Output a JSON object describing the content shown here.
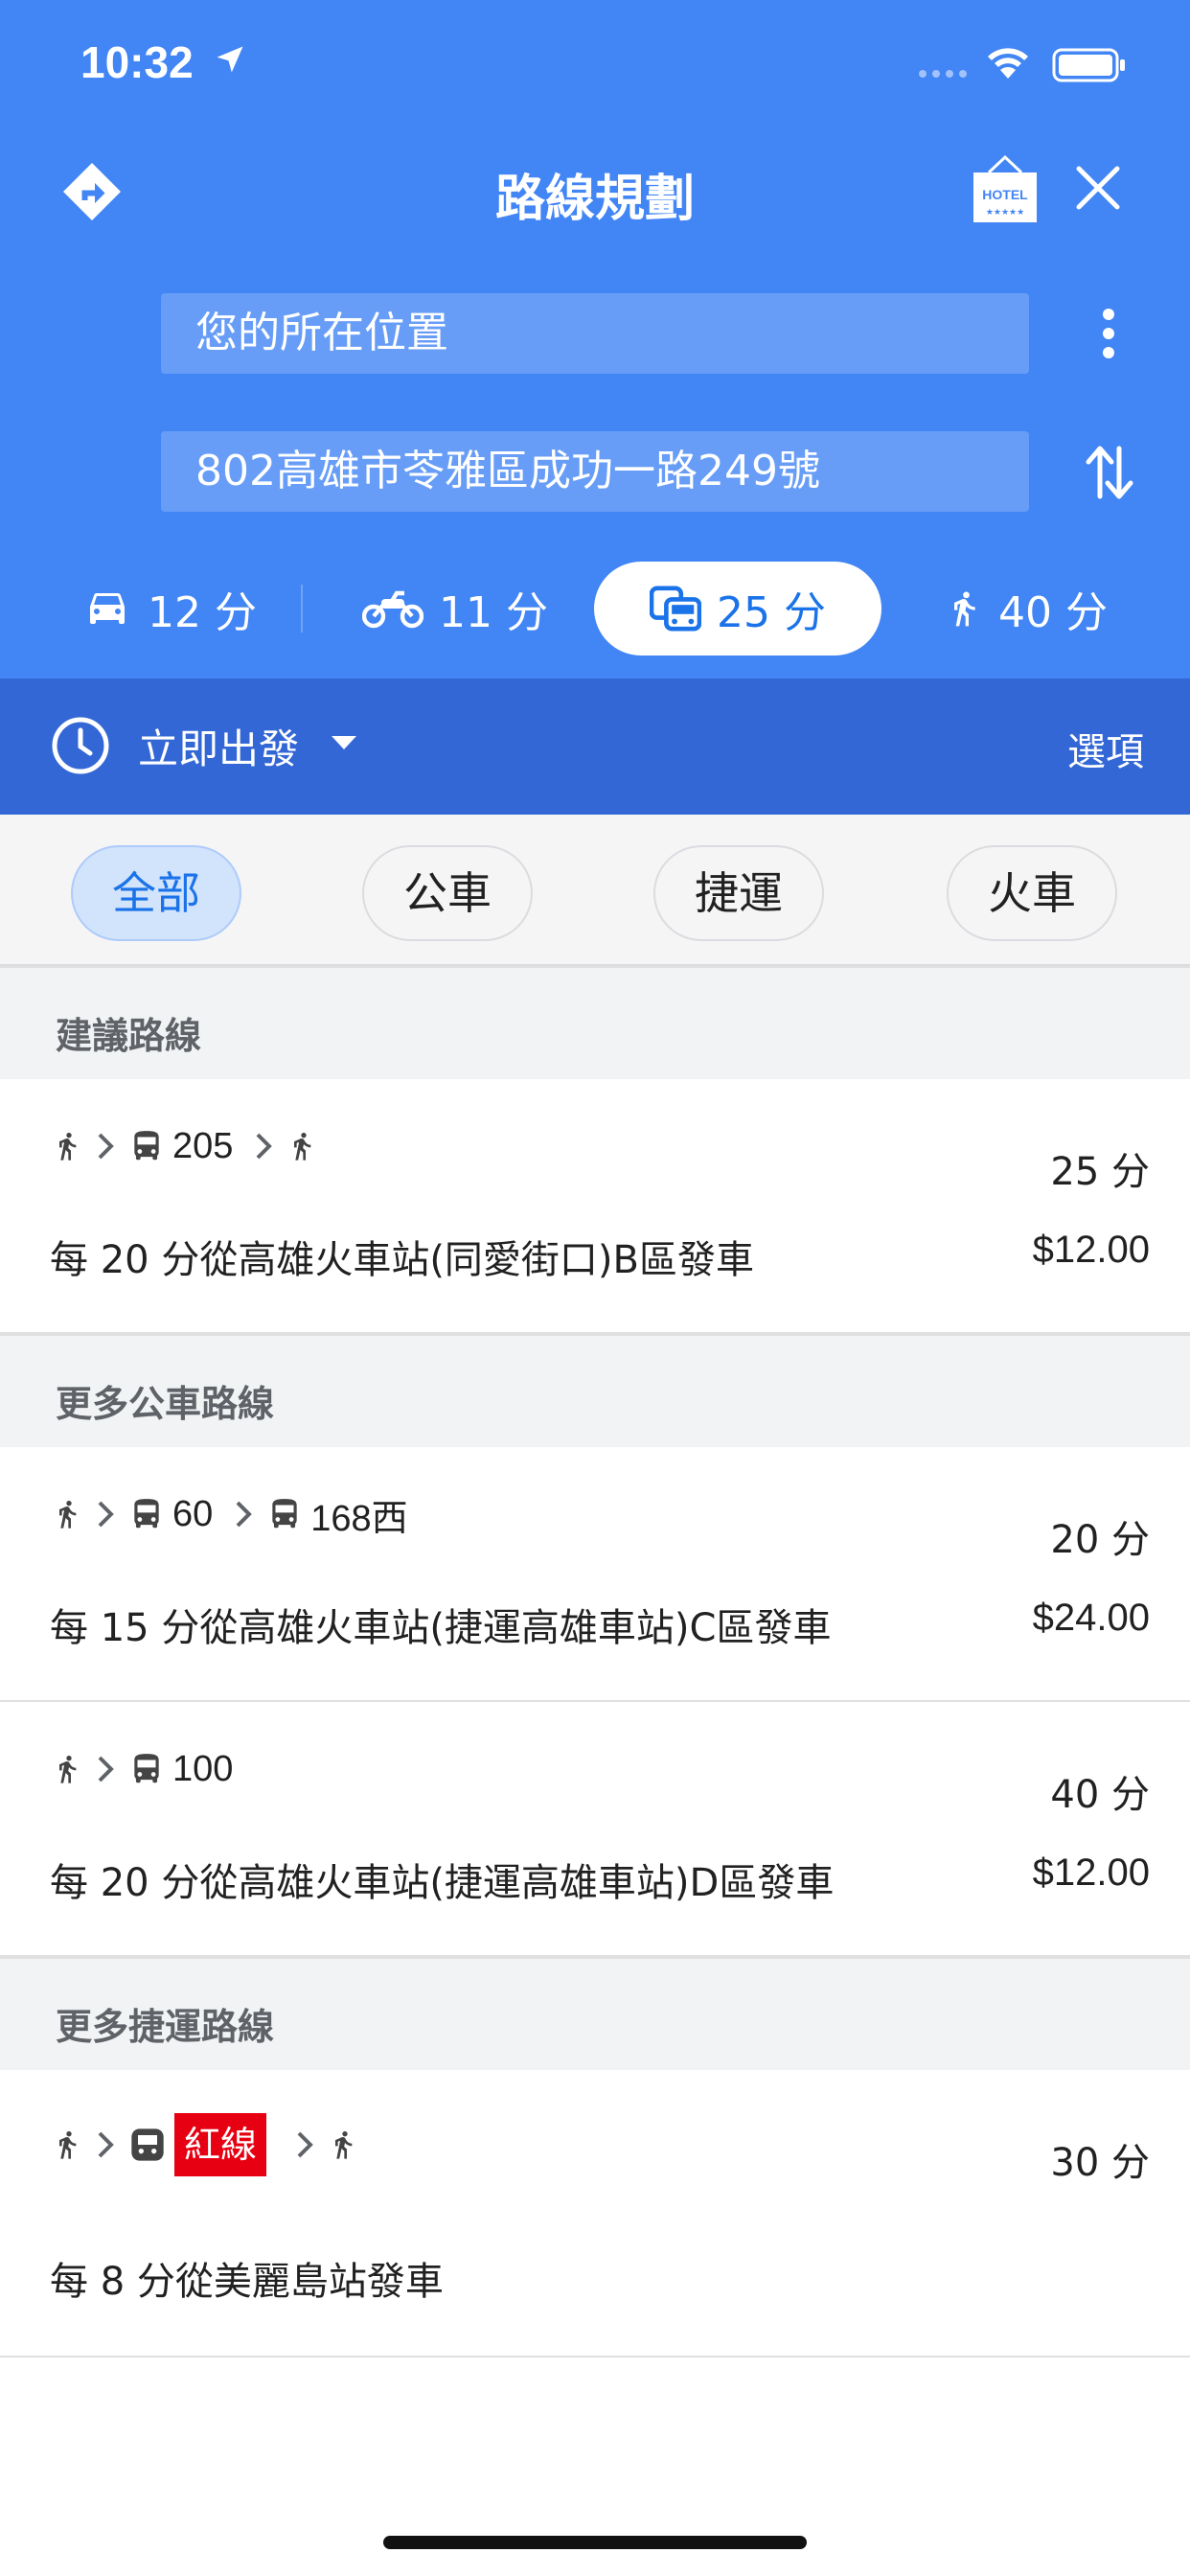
{
  "status_bar": {
    "time": "10:32"
  },
  "header": {
    "title": "路線規劃",
    "origin_value": "您的所在位置",
    "destination_value": "802高雄市苓雅區成功一路249號",
    "hotel_text": "HOTEL",
    "stars": "★★★★★"
  },
  "modes": [
    {
      "name": "drive",
      "label": "12 分",
      "icon": "car-icon"
    },
    {
      "name": "motorcycle",
      "label": "11 分",
      "icon": "motorcycle-icon"
    },
    {
      "name": "transit",
      "label": "25 分",
      "icon": "transit-icon",
      "selected": true
    },
    {
      "name": "walk",
      "label": "40 分",
      "icon": "walk-icon"
    }
  ],
  "depart": {
    "label": "立即出發",
    "options": "選項"
  },
  "filters": [
    {
      "label": "全部",
      "active": true
    },
    {
      "label": "公車"
    },
    {
      "label": "捷運"
    },
    {
      "label": "火車"
    }
  ],
  "sections": [
    {
      "title": "建議路線",
      "routes": [
        {
          "steps": [
            "walk",
            "bus:205",
            "walk"
          ],
          "duration": "25 分",
          "description": "每 20 分從高雄火車站(同愛街口)B區發車",
          "fare": "$12.00"
        }
      ]
    },
    {
      "title": "更多公車路線",
      "routes": [
        {
          "steps": [
            "walk",
            "bus:60",
            "bus:168西"
          ],
          "duration": "20 分",
          "description": "每 15 分從高雄火車站(捷運高雄車站)C區發車",
          "fare": "$24.00"
        },
        {
          "steps": [
            "walk",
            "bus:100"
          ],
          "duration": "40 分",
          "description": "每 20 分從高雄火車站(捷運高雄車站)D區發車",
          "fare": "$12.00"
        }
      ]
    },
    {
      "title": "更多捷運路線",
      "routes": [
        {
          "steps": [
            "walk",
            "metro:紅線",
            "walk"
          ],
          "duration": "30 分",
          "description": "每 8 分從美麗島站發車",
          "fare": ""
        }
      ]
    }
  ],
  "colors": {
    "header_blue": "#4285f4",
    "depart_blue": "#3367d6",
    "accent": "#1a73e8",
    "red_line": "#e60012"
  }
}
